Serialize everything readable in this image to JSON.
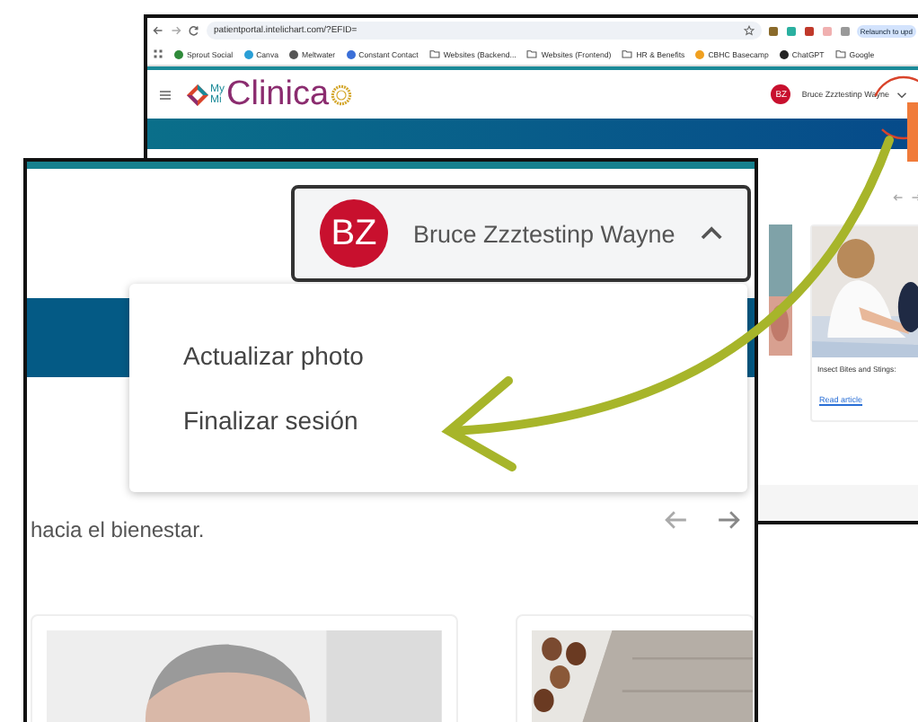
{
  "browser": {
    "url": "patientportal.intelichart.com/?EFID=",
    "relaunch_button": "Relaunch to upd",
    "bookmarks": [
      {
        "label": "Sprout Social",
        "kind": "site",
        "color": "#2f8a3a"
      },
      {
        "label": "Canva",
        "kind": "site",
        "color": "#2a9fd6"
      },
      {
        "label": "Meltwater",
        "kind": "site",
        "color": "#555555"
      },
      {
        "label": "Constant Contact",
        "kind": "site",
        "color": "#3b6fd8"
      },
      {
        "label": "Websites (Backend...",
        "kind": "folder"
      },
      {
        "label": "Websites (Frontend)",
        "kind": "folder"
      },
      {
        "label": "HR & Benefits",
        "kind": "folder"
      },
      {
        "label": "CBHC Basecamp",
        "kind": "site",
        "color": "#f0a020"
      },
      {
        "label": "ChatGPT",
        "kind": "site",
        "color": "#222222"
      },
      {
        "label": "Google",
        "kind": "folder"
      }
    ]
  },
  "app_header": {
    "logo_top": "My",
    "logo_bottom": "Mi",
    "logo_name": "Clinica",
    "avatar_initials": "BZ",
    "user_name": "Bruce Zzztestinp Wayne",
    "menu_expanded": false
  },
  "article_card": {
    "title": "Insect Bites and Stings:",
    "link": "Read article"
  },
  "zoom_inset": {
    "avatar_initials": "BZ",
    "user_name": "Bruce Zzztestinp Wayne",
    "menu_expanded": true,
    "menu_items": [
      "Actualizar photo",
      "Finalizar sesión"
    ],
    "intro_text": "hacia el bienestar."
  }
}
